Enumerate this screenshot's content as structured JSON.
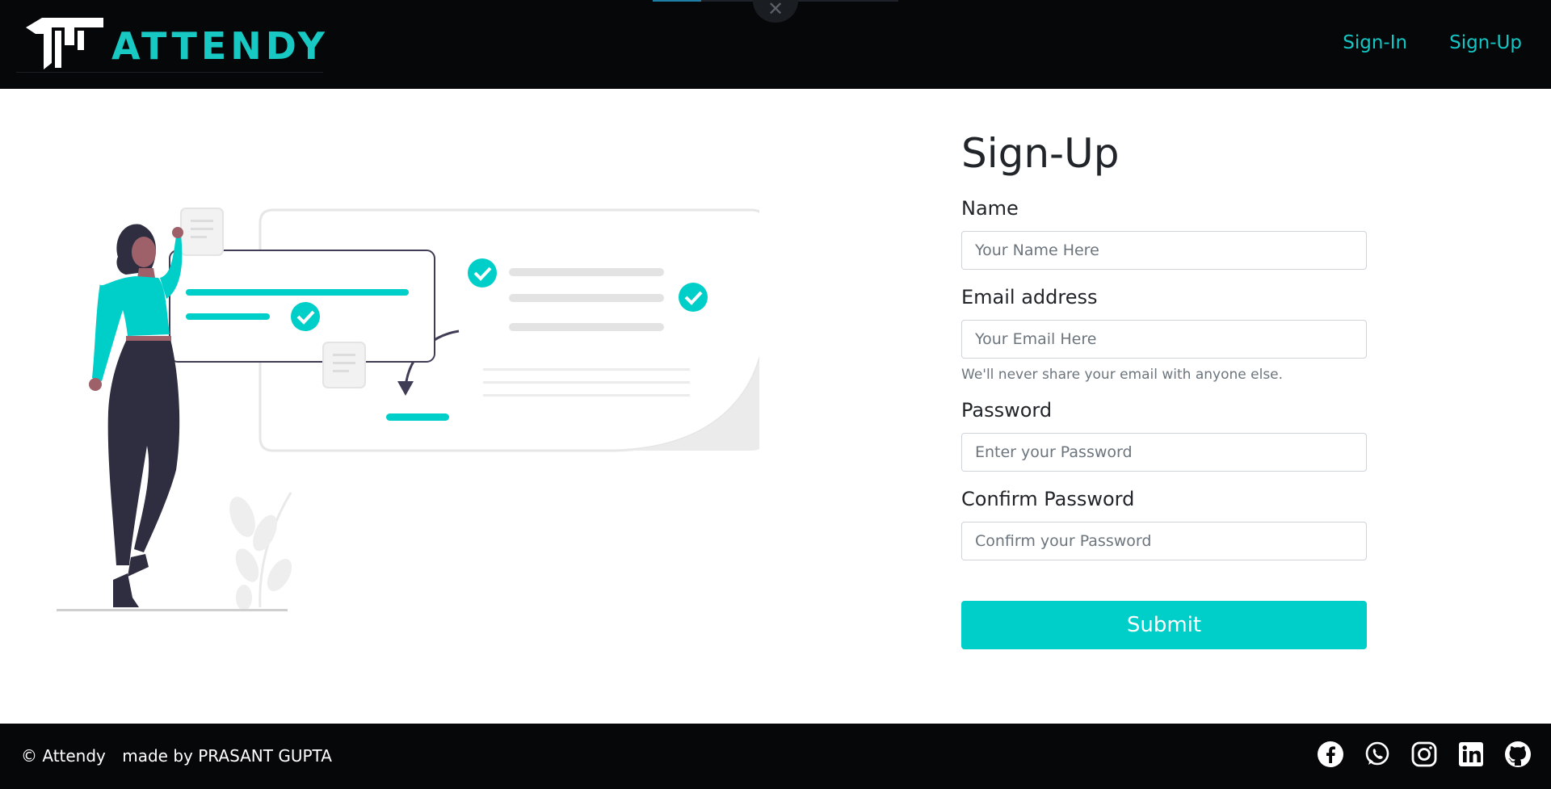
{
  "header": {
    "brand": "ATTENDY",
    "nav": {
      "signin": "Sign-In",
      "signup": "Sign-Up"
    },
    "close_glyph": "✕"
  },
  "form": {
    "title": "Sign-Up",
    "name_label": "Name",
    "name_placeholder": "Your Name Here",
    "email_label": "Email address",
    "email_placeholder": "Your Email Here",
    "email_help": "We'll never share your email with anyone else.",
    "password_label": "Password",
    "password_placeholder": "Enter your Password",
    "confirm_label": "Confirm Password",
    "confirm_placeholder": "Confirm your Password",
    "submit": "Submit"
  },
  "footer": {
    "copyright": "© Attendy",
    "credit": "made by PRASANT GUPTA",
    "social": [
      "facebook-icon",
      "whatsapp-icon",
      "instagram-icon",
      "linkedin-icon",
      "github-icon"
    ]
  },
  "colors": {
    "accent": "#00cec9",
    "navbar": "#060709",
    "text": "#212529"
  }
}
